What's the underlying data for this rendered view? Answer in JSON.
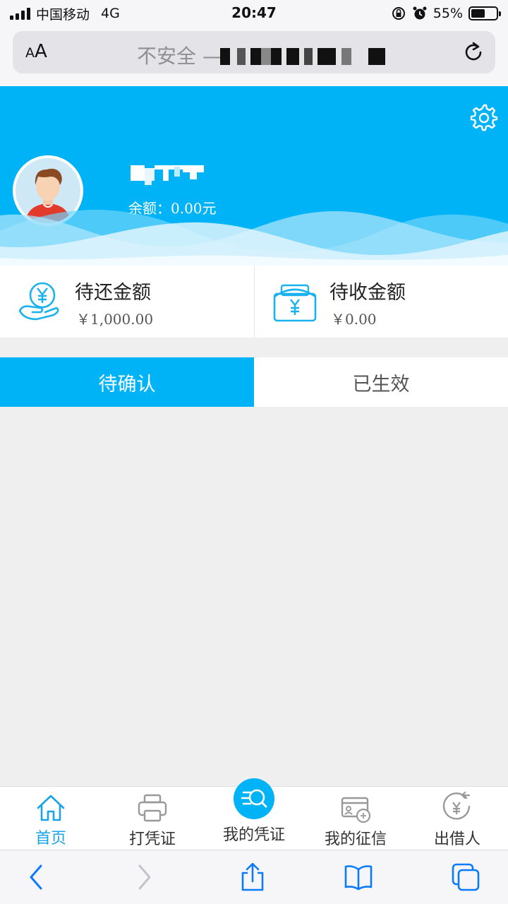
{
  "status_bar": {
    "carrier": "中国移动",
    "network": "4G",
    "time": "20:47",
    "battery_percent": "55%",
    "battery_level": 0.55
  },
  "url_bar": {
    "text_size_label": "AA",
    "security_text": "不安全 —",
    "reload_icon": "reload-icon"
  },
  "header": {
    "settings_icon": "gear-icon",
    "balance_text": "余额：0.00元",
    "bg_color": "#00b2f6"
  },
  "amounts": [
    {
      "label": "待还金额",
      "value": "￥1,000.00",
      "icon": "hand-yuan-icon"
    },
    {
      "label": "待收金额",
      "value": "￥0.00",
      "icon": "envelope-yuan-icon"
    }
  ],
  "tabs": [
    {
      "label": "待确认",
      "active": true
    },
    {
      "label": "已生效",
      "active": false
    }
  ],
  "bottom_nav": [
    {
      "label": "首页",
      "icon": "home-icon",
      "active": true
    },
    {
      "label": "打凭证",
      "icon": "printer-icon",
      "active": false
    },
    {
      "label": "我的凭证",
      "icon": "search-list-icon",
      "active": false
    },
    {
      "label": "我的征信",
      "icon": "credit-card-icon",
      "active": false
    },
    {
      "label": "出借人",
      "icon": "yuan-return-icon",
      "active": false
    }
  ],
  "browser_toolbar": [
    {
      "icon": "back-icon"
    },
    {
      "icon": "forward-icon"
    },
    {
      "icon": "share-icon"
    },
    {
      "icon": "bookmarks-icon"
    },
    {
      "icon": "tabs-icon"
    }
  ],
  "colors": {
    "accent": "#00b2f6",
    "active_nav": "#1aa3e8",
    "ios_blue": "#0a7aff"
  }
}
